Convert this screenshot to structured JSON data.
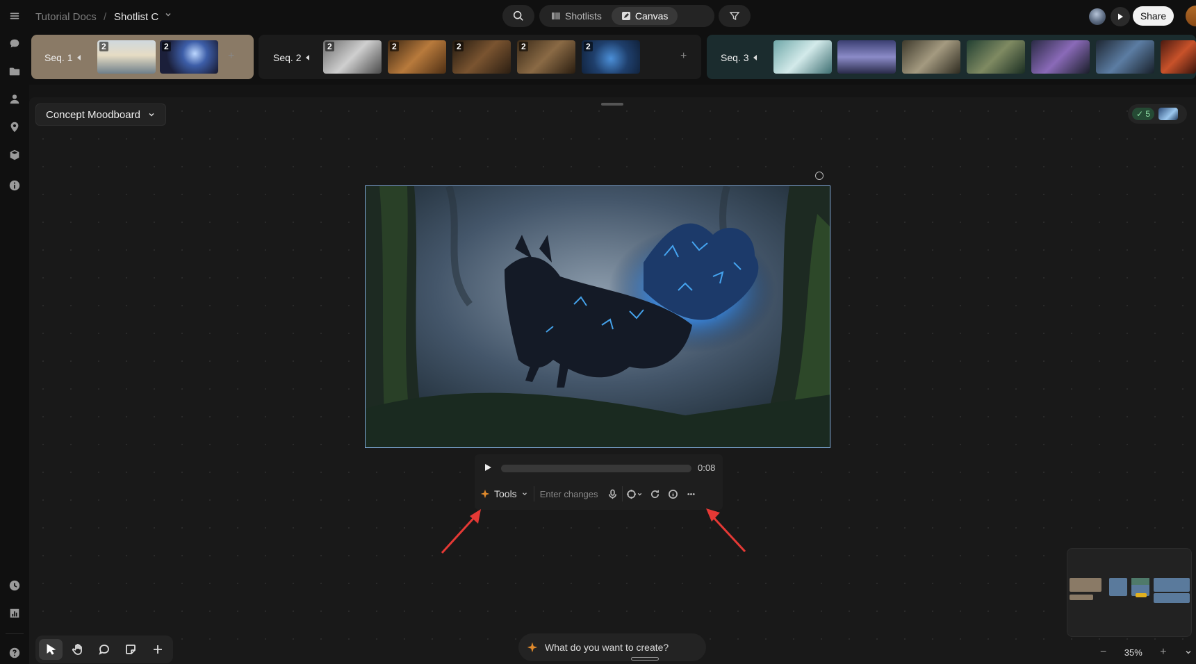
{
  "breadcrumb": {
    "root": "Tutorial Docs",
    "separator": "/",
    "current": "Shotlist C"
  },
  "view_toggle": {
    "shotlists_label": "Shotlists",
    "canvas_label": "Canvas",
    "active": "Canvas"
  },
  "header_actions": {
    "share_label": "Share"
  },
  "sequences": [
    {
      "label": "Seq. 1",
      "thumbs": [
        {
          "badge": "2"
        },
        {
          "badge": "2"
        }
      ],
      "add": "+"
    },
    {
      "label": "Seq. 2",
      "thumbs": [
        {
          "badge": "2"
        },
        {
          "badge": "2"
        },
        {
          "badge": "2"
        },
        {
          "badge": "2"
        },
        {
          "badge": "2"
        }
      ],
      "add": "+"
    },
    {
      "label": "Seq. 3",
      "thumbs": [
        {},
        {},
        {},
        {},
        {},
        {},
        {}
      ]
    }
  ],
  "board": {
    "selected": "Concept Moodboard"
  },
  "collaborators": {
    "count": "5"
  },
  "player": {
    "time": "0:08",
    "progress": 0.0
  },
  "toolbar": {
    "tools_label": "Tools",
    "change_placeholder": "Enter changes..."
  },
  "prompt": {
    "placeholder": "What do you want to create?"
  },
  "zoom": {
    "level": "35%",
    "minus": "−",
    "plus": "+"
  },
  "colors": {
    "accent": "#e08a2c",
    "selection": "#7fa9d8",
    "arrow": "#e53935"
  }
}
